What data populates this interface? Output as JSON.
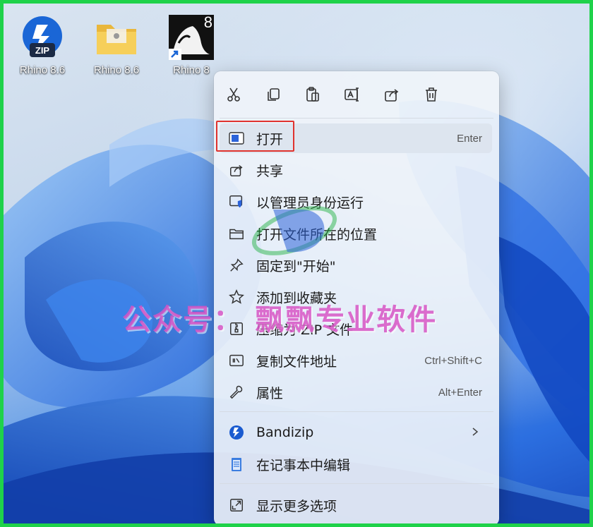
{
  "desktop": {
    "icons": [
      {
        "label": "Rhino 8.6",
        "icon": "zip-archive-icon"
      },
      {
        "label": "Rhino 8.6",
        "icon": "folder-icon"
      },
      {
        "label": "Rhino 8",
        "icon": "rhino-app-shortcut-icon",
        "badge": "8"
      }
    ]
  },
  "context_menu": {
    "toolbar": [
      {
        "icon": "cut-icon"
      },
      {
        "icon": "copy-icon"
      },
      {
        "icon": "paste-icon"
      },
      {
        "icon": "rename-icon"
      },
      {
        "icon": "share-icon"
      },
      {
        "icon": "delete-icon"
      }
    ],
    "items": [
      {
        "label": "打开",
        "shortcut": "Enter",
        "icon": "open-icon",
        "highlighted": true
      },
      {
        "label": "共享",
        "icon": "share-icon"
      },
      {
        "label": "以管理员身份运行",
        "icon": "run-as-admin-icon"
      },
      {
        "label": "打开文件所在的位置",
        "icon": "folder-outline-icon"
      },
      {
        "label": "固定到\"开始\"",
        "icon": "pin-icon"
      },
      {
        "label": "添加到收藏夹",
        "icon": "star-icon"
      },
      {
        "label": "压缩为 ZIP 文件",
        "icon": "zip-icon"
      },
      {
        "label": "复制文件地址",
        "shortcut": "Ctrl+Shift+C",
        "icon": "copy-path-icon"
      },
      {
        "label": "属性",
        "shortcut": "Alt+Enter",
        "icon": "wrench-icon"
      },
      {
        "label": "Bandizip",
        "icon": "bandizip-icon",
        "submenu": true
      },
      {
        "label": "在记事本中编辑",
        "icon": "notepad-icon"
      },
      {
        "label": "显示更多选项",
        "icon": "more-options-icon"
      }
    ]
  },
  "watermark": "公众号： 飘飘专业软件",
  "colors": {
    "border": "#1fd24a",
    "highlight": "#e0332e",
    "accent": "#2b63d9"
  }
}
